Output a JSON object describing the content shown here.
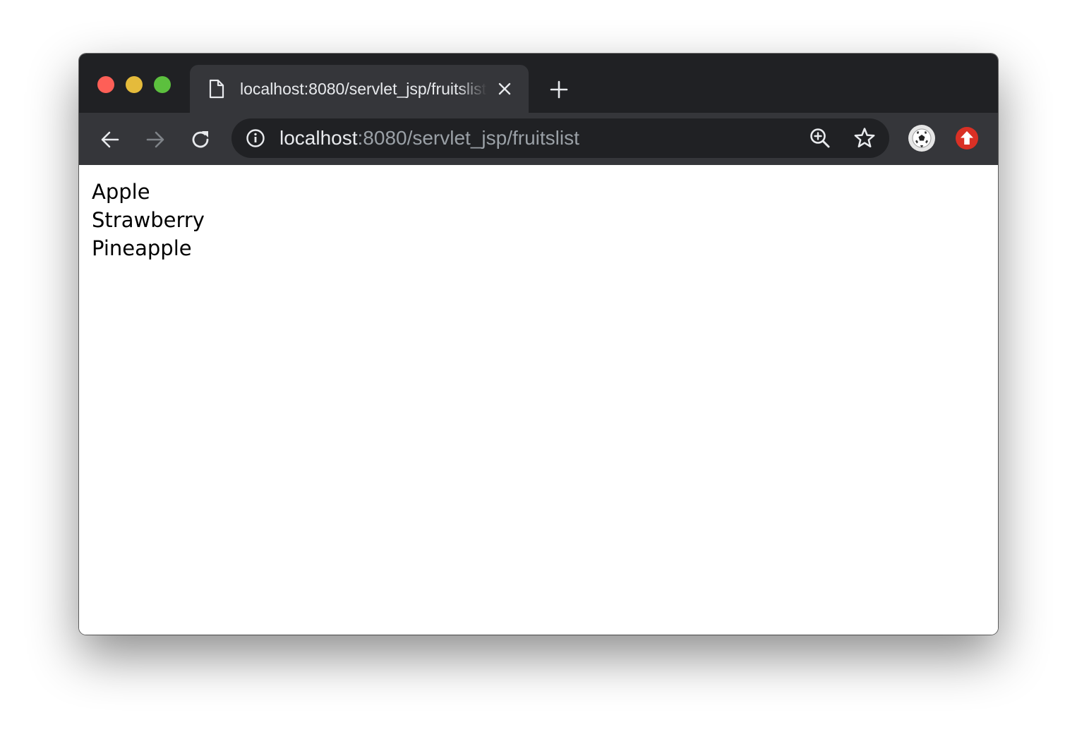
{
  "browser": {
    "window_controls": {
      "close_color": "#fe5f57",
      "minimize_color": "#e5bb3b",
      "maximize_color": "#5cc03e"
    },
    "tab": {
      "title": "localhost:8080/servlet_jsp/fruitslist",
      "icon": "page-icon",
      "close_icon": "close-icon"
    },
    "new_tab_icon": "plus-icon",
    "toolbar": {
      "back_icon": "arrow-left-icon",
      "forward_icon": "arrow-right-icon",
      "reload_icon": "reload-icon"
    },
    "omnibox": {
      "security_icon": "info-icon",
      "url_host": "localhost",
      "url_rest": ":8080/servlet_jsp/fruitslist",
      "zoom_icon": "zoom-in-icon",
      "bookmark_icon": "star-icon"
    },
    "extensions": [
      {
        "icon": "soccer-ball-icon"
      },
      {
        "icon": "upload-arrow-icon",
        "color": "#d93025"
      }
    ]
  },
  "page": {
    "fruits": [
      "Apple",
      "Strawberry",
      "Pineapple"
    ]
  }
}
